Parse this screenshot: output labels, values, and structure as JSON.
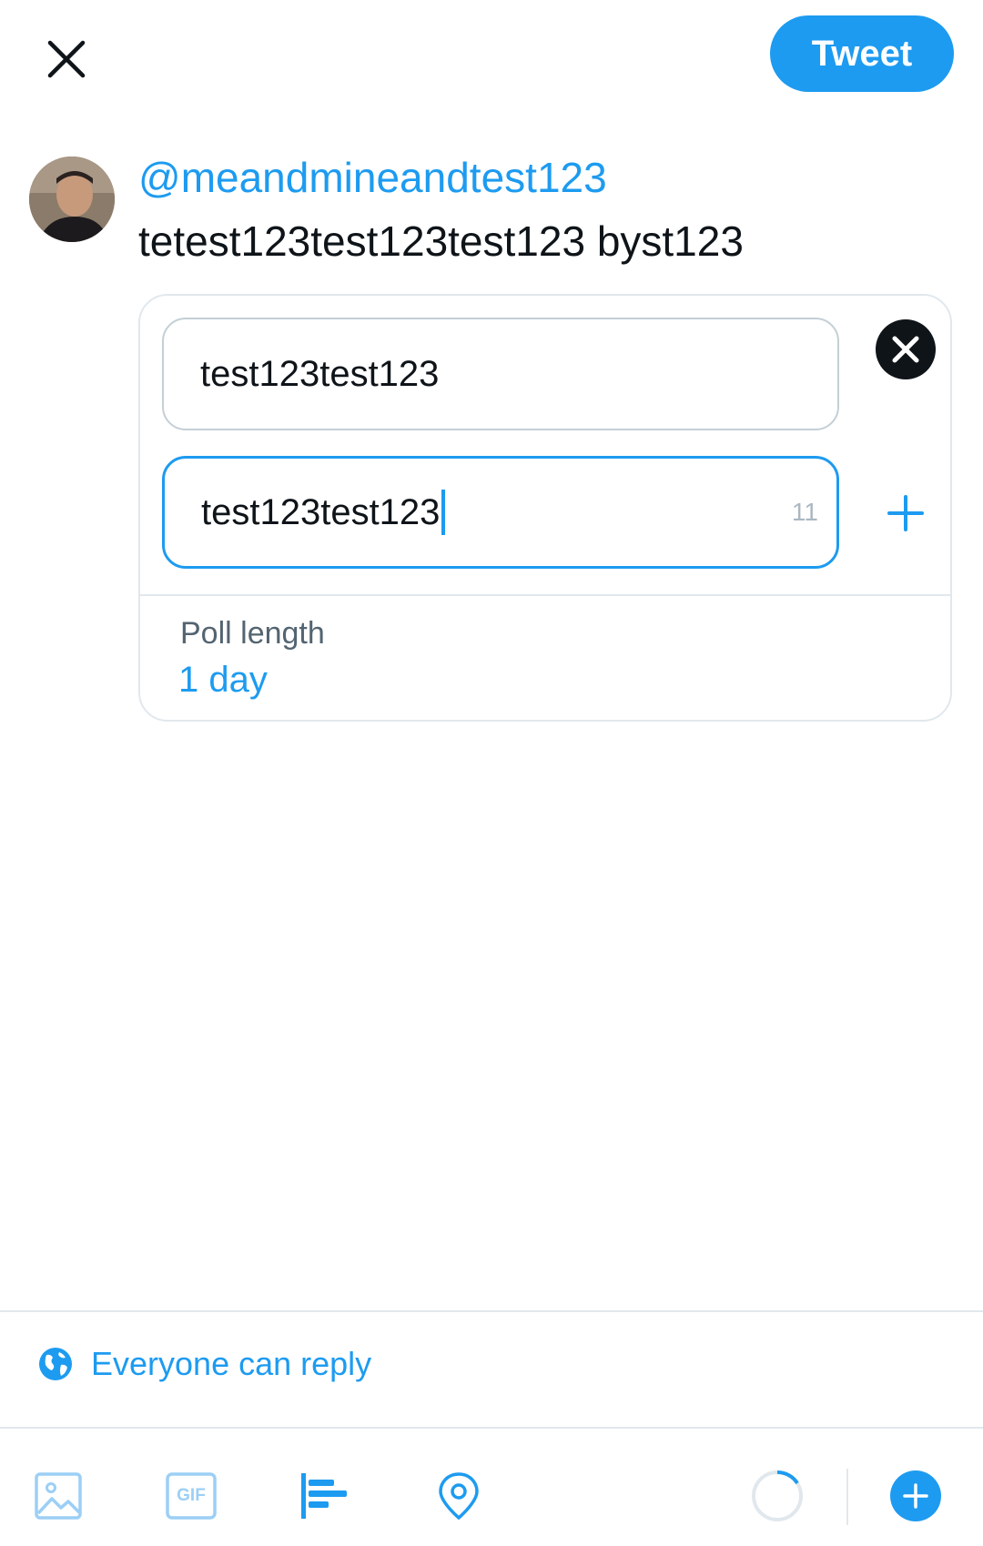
{
  "header": {
    "tweet_button_label": "Tweet"
  },
  "compose": {
    "mention": "@meandmineandtest123",
    "text": "tetest123test123test123 byst123"
  },
  "poll": {
    "choices": [
      {
        "value": "test123test123"
      },
      {
        "value": "test123test123",
        "chars_remaining": "11"
      }
    ],
    "length_label": "Poll length",
    "length_value": "1 day"
  },
  "reply_setting": {
    "label": "Everyone can reply"
  },
  "toolbar": {
    "icons": [
      "image-icon",
      "gif-icon",
      "poll-icon",
      "location-icon",
      "character-progress-icon",
      "add-thread-icon"
    ],
    "gif_label": "GIF"
  },
  "colors": {
    "accent": "#1d9bf0",
    "text": "#0f1419",
    "muted": "#536471",
    "border": "#e1e8ed"
  }
}
